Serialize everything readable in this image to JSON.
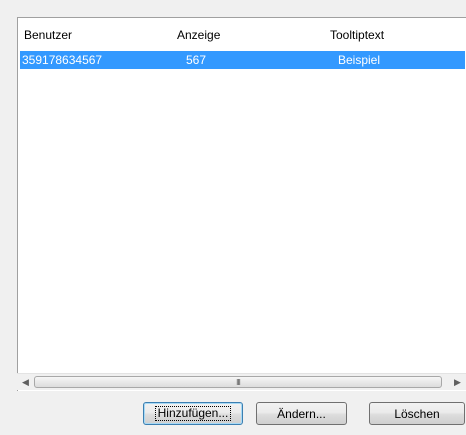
{
  "listview": {
    "columns": [
      "Benutzer",
      "Anzeige",
      "Tooltiptext"
    ],
    "rows": [
      {
        "benutzer": "359178634567",
        "anzeige": "567",
        "tooltiptext": "Beispiel",
        "selected": true
      }
    ],
    "selection_color": "#3399ff"
  },
  "scrollbar": {
    "thumb_grip": "III"
  },
  "buttons": {
    "add_label": "Hinzufügen...",
    "edit_label": "Ändern...",
    "delete_label": "Löschen"
  }
}
